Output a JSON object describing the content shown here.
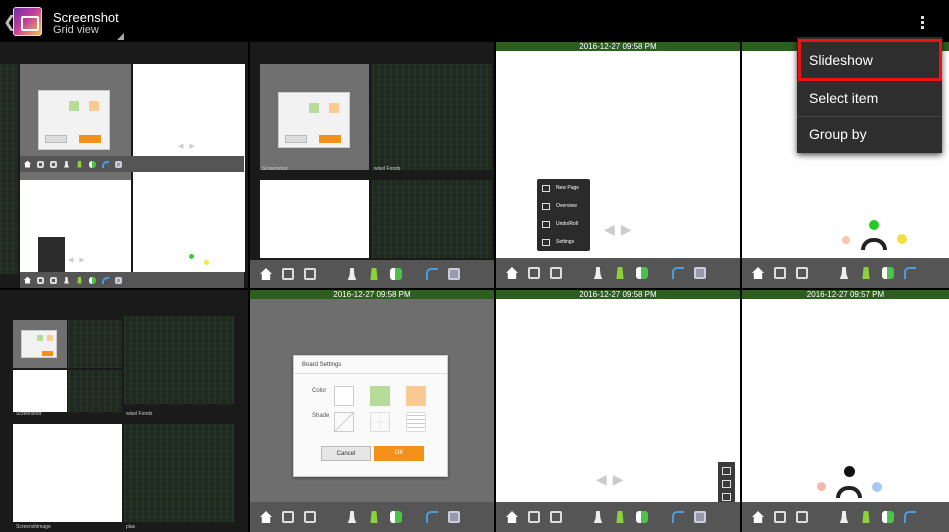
{
  "app": {
    "title": "Screenshot",
    "subtitle": "Grid view"
  },
  "menu": {
    "items": [
      {
        "label": "Slideshow"
      },
      {
        "label": "Select item"
      },
      {
        "label": "Group by"
      }
    ]
  },
  "thumbnails": {
    "timestamps": [
      "2016-12-27 09:58 PM",
      "2016-12-27 09:58 PM",
      "2016-12-27 09:58 PM",
      "2016-12-27 09:57 PM"
    ],
    "folder_labels": [
      "Screenshot",
      "wisel Fonds",
      "Screenshot",
      "wisel Fonds",
      "Screenshimage",
      "plas"
    ]
  },
  "dialog": {
    "title": "Board Settings",
    "color_label": "Color",
    "shade_label": "Shade",
    "cancel": "Cancel",
    "ok": "OK"
  },
  "page_menu": {
    "items": [
      "New Page",
      "Overview",
      "Undo/Roll",
      "Settings"
    ]
  },
  "colors": {
    "accent_green": "#2c5e1e",
    "ok_orange": "#f39019",
    "highlight_red": "#ee1111",
    "menu_bg": "#2e2e2e"
  },
  "icons": [
    "back-chevron-icon",
    "gallery-app-icon",
    "overflow-menu-icon",
    "home-icon",
    "pen-icon",
    "marker-icon",
    "undo-icon",
    "camera-icon"
  ]
}
